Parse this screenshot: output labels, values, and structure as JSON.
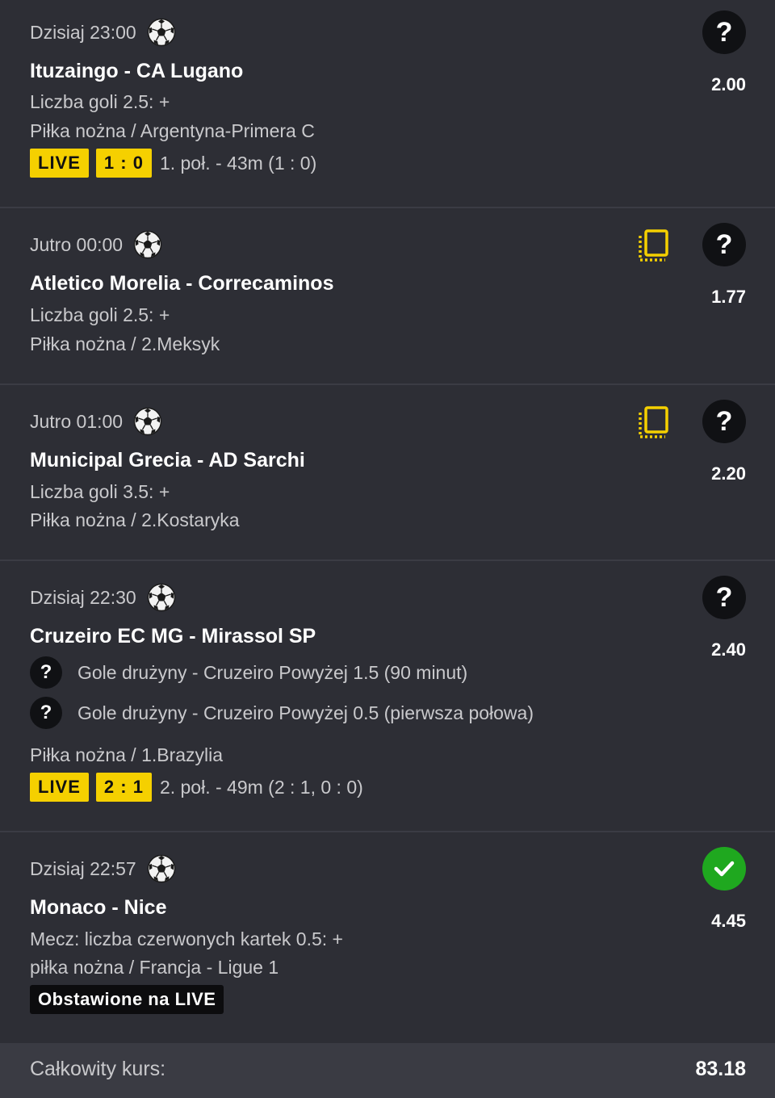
{
  "bets": [
    {
      "time": "Dzisiaj 23:00",
      "match": "Ituzaingo - CA Lugano",
      "market": "Liczba goli 2.5: +",
      "league": "Piłka nożna / Argentyna-Primera C",
      "odds": "2.00",
      "status": "?",
      "live_label": "LIVE",
      "score": "1 : 0",
      "live_info": "1. poł. - 43m (1 : 0)"
    },
    {
      "time": "Jutro 00:00",
      "match": "Atletico Morelia - Correcaminos",
      "market": "Liczba goli 2.5: +",
      "league": "Piłka nożna / 2.Meksyk",
      "odds": "1.77",
      "status": "?"
    },
    {
      "time": "Jutro 01:00",
      "match": "Municipal Grecia - AD Sarchi",
      "market": "Liczba goli 3.5: +",
      "league": "Piłka nożna / 2.Kostaryka",
      "odds": "2.20",
      "status": "?"
    },
    {
      "time": "Dzisiaj 22:30",
      "match": "Cruzeiro EC MG - Mirassol SP",
      "sub_bets": [
        {
          "status": "?",
          "text": "Gole drużyny - Cruzeiro Powyżej 1.5 (90 minut)"
        },
        {
          "status": "?",
          "text": "Gole drużyny - Cruzeiro Powyżej 0.5 (pierwsza połowa)"
        }
      ],
      "league": "Piłka nożna / 1.Brazylia",
      "odds": "2.40",
      "status": "?",
      "live_label": "LIVE",
      "score": "2 : 1",
      "live_info": "2. poł. - 49m (2 : 1, 0 : 0)"
    },
    {
      "time": "Dzisiaj 22:57",
      "match": "Monaco - Nice",
      "market": "Mecz: liczba czerwonych kartek 0.5: +",
      "league": "piłka nożna / Francja - Ligue 1",
      "odds": "4.45",
      "status": "won",
      "badge": "Obstawione na LIVE"
    }
  ],
  "footer": {
    "label": "Całkowity kurs:",
    "value": "83.18"
  },
  "icons": {
    "sport": "soccer-ball-icon",
    "copy": "copy-bet-icon",
    "unknown": "question-mark-icon",
    "won": "checkmark-icon"
  },
  "colors": {
    "background": "#2d2e35",
    "live_badge": "#f5d000",
    "won": "#1fa81f",
    "footer": "#3a3b43"
  }
}
